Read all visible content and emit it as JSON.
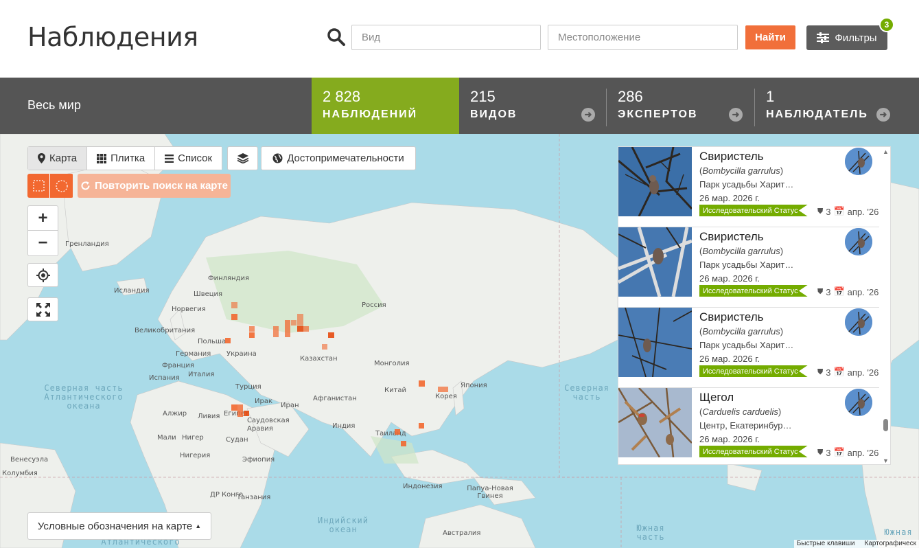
{
  "header": {
    "title": "Наблюдения",
    "species_placeholder": "Вид",
    "location_placeholder": "Местоположение",
    "find_label": "Найти",
    "filters_label": "Фильтры",
    "filters_count": "3"
  },
  "stats": {
    "place": "Весь мир",
    "observations": {
      "count": "2 828",
      "label": "НАБЛЮДЕНИЙ"
    },
    "species": {
      "count": "215",
      "label": "ВИДОВ"
    },
    "identifiers": {
      "count": "286",
      "label": "ЭКСПЕРТОВ"
    },
    "observers": {
      "count": "1",
      "label": "НАБЛЮДАТЕЛЬ"
    }
  },
  "map": {
    "tabs": [
      {
        "label": "Карта",
        "icon": "map-pin-icon"
      },
      {
        "label": "Плитка",
        "icon": "grid-icon"
      },
      {
        "label": "Список",
        "icon": "list-icon"
      }
    ],
    "places_label": "Достопримечательности",
    "redo_label": "Повторить поиск на карте",
    "legend_label": "Условные обозначения на карте",
    "footer": [
      "Быстрые клавиши",
      "Картографическ"
    ],
    "labels": {
      "greenland": "Гренландия",
      "iceland": "Исландия",
      "finland": "Финляндия",
      "sweden": "Швеция",
      "norway": "Норвегия",
      "uk": "Великобритания",
      "poland": "Польша",
      "germany": "Германия",
      "ukraine": "Украина",
      "france": "Франция",
      "spain": "Испания",
      "italy": "Италия",
      "russia": "Россия",
      "kazakhstan": "Казахстан",
      "mongolia": "Монголия",
      "china": "Китай",
      "korea": "Корея",
      "japan": "Япония",
      "turkey": "Турция",
      "iraq": "Ирак",
      "iran": "Иран",
      "afghanistan": "Афганистан",
      "egypt": "Египет",
      "saudi": "Саудовская Аравия",
      "india": "Индия",
      "thailand": "Таиланд",
      "algeria": "Алжир",
      "libya": "Ливия",
      "mali": "Мали",
      "niger": "Нигер",
      "sudan": "Судан",
      "nigeria": "Нигерия",
      "ethiopia": "Эфиопия",
      "venezuela": "Венесуэла",
      "colombia": "Колумбия",
      "dr_congo": "ДР Конго",
      "tanzania": "Танзания",
      "indonesia": "Индонезия",
      "png": "Папуа-Новая Гвинея",
      "australia": "Австралия",
      "north_atlantic": "Северная часть Атлантического океана",
      "north_pacific": "Северная часть Тихий океан",
      "indian_ocean": "Индийский океан",
      "south_atlantic": "Атлантического",
      "south_pacific": "Южная часть",
      "south_pacific_right": "Южная"
    }
  },
  "observations": [
    {
      "name": "Свиристель",
      "sci": "Bombycilla garrulus",
      "place": "Парк усадьбы Харит…",
      "date": "26 мар. 2026 г.",
      "grade": "Исследовательский Статус",
      "ids": "3",
      "added": "апр. '26",
      "photo": "waxwing"
    },
    {
      "name": "Свиристель",
      "sci": "Bombycilla garrulus",
      "place": "Парк усадьбы Харит…",
      "date": "26 мар. 2026 г.",
      "grade": "Исследовательский Статус",
      "ids": "3",
      "added": "апр. '26",
      "photo": "waxwing"
    },
    {
      "name": "Свиристель",
      "sci": "Bombycilla garrulus",
      "place": "Парк усадьбы Харит…",
      "date": "26 мар. 2026 г.",
      "grade": "Исследовательский Статус",
      "ids": "3",
      "added": "апр. '26",
      "photo": "waxwing"
    },
    {
      "name": "Щегол",
      "sci": "Carduelis carduelis",
      "place": "Центр, Екатеринбур…",
      "date": "26 мар. 2026 г.",
      "grade": "Исследовательский Статус",
      "ids": "3",
      "added": "апр. '26",
      "photo": "goldfinch"
    }
  ],
  "colors": {
    "accent": "#f26830",
    "active_stat": "#85ab1e",
    "grade": "#74ac00",
    "bar": "#555555"
  }
}
